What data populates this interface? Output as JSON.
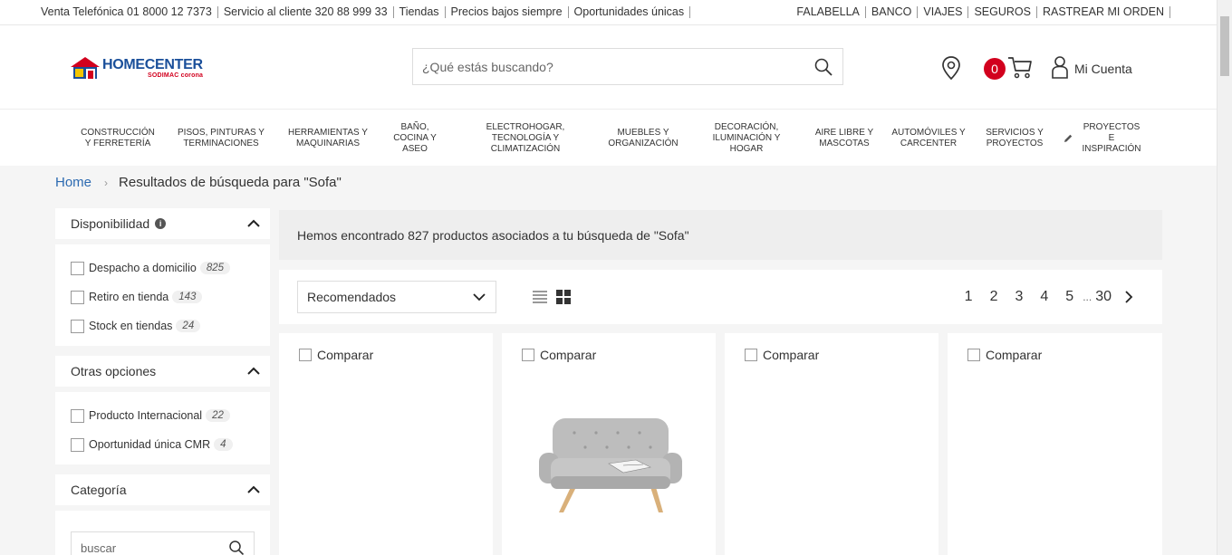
{
  "topbar": {
    "left": [
      {
        "label": "Venta Telefónica ",
        "value": "01 8000 12 7373"
      },
      {
        "label": "Servicio al cliente ",
        "value": "320 88 999 33"
      },
      {
        "label": "Tiendas",
        "value": ""
      },
      {
        "label": "Precios bajos siempre",
        "value": ""
      },
      {
        "label": "Oportunidades únicas",
        "value": ""
      }
    ],
    "right": [
      "FALABELLA",
      "BANCO",
      "VIAJES",
      "SEGUROS",
      "RASTREAR MI ORDEN"
    ]
  },
  "header": {
    "logo_main": "HOMECENTER",
    "logo_sub": "SODIMAC corona",
    "search_placeholder": "¿Qué estás buscando?",
    "cart_count": "0",
    "account_label": "Mi Cuenta",
    "icons": [
      "search-icon",
      "location-pin-icon",
      "cart-icon",
      "user-icon"
    ]
  },
  "categories": [
    "CONSTRUCCIÓN Y FERRETERÍA",
    "PISOS, PINTURAS Y TERMINACIONES",
    "HERRAMIENTAS Y MAQUINARIAS",
    "BAÑO, COCINA Y ASEO",
    "ELECTROHOGAR, TECNOLOGÍA Y CLIMATIZACIÓN",
    "MUEBLES Y ORGANIZACIÓN",
    "DECORACIÓN, ILUMINACIÓN Y HOGAR",
    "AIRE LIBRE Y MASCOTAS",
    "AUTOMÓVILES Y CARCENTER",
    "SERVICIOS Y PROYECTOS",
    "PROYECTOS E INSPIRACIÓN"
  ],
  "breadcrumb": {
    "home": "Home",
    "current": "Resultados de búsqueda para \"Sofa\""
  },
  "filters": {
    "disponibilidad": {
      "title": "Disponibilidad",
      "options": [
        {
          "label": "Despacho a domicilio",
          "count": "825"
        },
        {
          "label": "Retiro en tienda",
          "count": "143"
        },
        {
          "label": "Stock en tiendas",
          "count": "24"
        }
      ]
    },
    "otras": {
      "title": "Otras opciones",
      "options": [
        {
          "label": "Producto Internacional",
          "count": "22"
        },
        {
          "label": "Oportunidad única CMR",
          "count": "4"
        }
      ]
    },
    "categoria": {
      "title": "Categoría",
      "search_placeholder": "buscar"
    }
  },
  "results": {
    "message": "Hemos encontrado 827 productos asociados a tu búsqueda de \"Sofa\"",
    "sort_selected": "Recomendados",
    "pages": [
      "1",
      "2",
      "3",
      "4",
      "5"
    ],
    "ellipsis": "...",
    "last_page": "30",
    "compare_label": "Comparar"
  },
  "colors": {
    "brand_blue": "#1a4f9a",
    "brand_red": "#d2001e",
    "link_blue": "#2c6ab1"
  }
}
